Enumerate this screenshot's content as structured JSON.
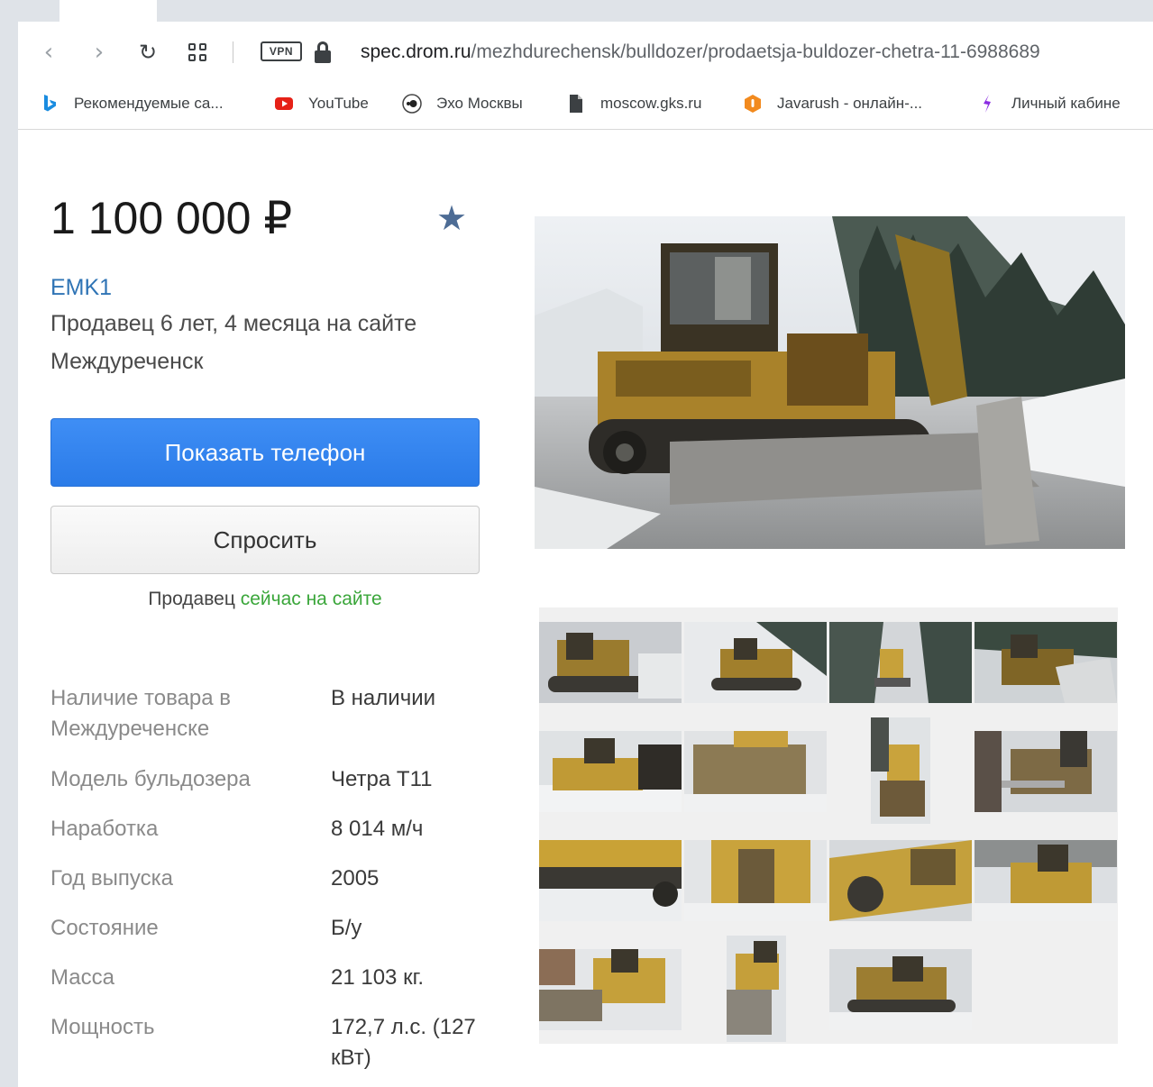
{
  "browser": {
    "url_host": "spec.drom.ru",
    "url_path": "/mezhdurechensk/bulldozer/prodaetsja-buldozer-chetra-11-6988689",
    "vpn_label": "VPN",
    "bookmarks": [
      {
        "label": "Рекомендуемые са...",
        "icon": "bing-icon"
      },
      {
        "label": "YouTube",
        "icon": "youtube-icon"
      },
      {
        "label": "Эхо Москвы",
        "icon": "echo-icon"
      },
      {
        "label": "moscow.gks.ru",
        "icon": "document-icon"
      },
      {
        "label": "Javarush - онлайн-...",
        "icon": "javarush-icon"
      },
      {
        "label": "Личный кабине",
        "icon": "cabinet-icon"
      }
    ]
  },
  "listing": {
    "price": "1 100 000 ₽",
    "seller_name": "EMK1",
    "seller_tenure": "Продавец 6 лет, 4 месяца на сайте",
    "seller_city": "Междуреченск",
    "show_phone_label": "Показать телефон",
    "ask_label": "Спросить",
    "online_prefix": "Продавец",
    "online_status": "сейчас на сайте"
  },
  "specs": [
    {
      "key": "Наличие товара в Междуреченске",
      "value": "В наличии"
    },
    {
      "key": "Модель бульдозера",
      "value": "Четра Т11"
    },
    {
      "key": "Наработка",
      "value": "8 014 м/ч"
    },
    {
      "key": "Год выпуска",
      "value": "2005"
    },
    {
      "key": "Состояние",
      "value": "Б/у"
    },
    {
      "key": "Масса",
      "value": "21 103 кг."
    },
    {
      "key": "Мощность",
      "value": "172,7 л.с. (127 кВт)"
    }
  ],
  "colors": {
    "primary_button": "#3f8ef5",
    "link": "#2f74b5",
    "online": "#3aa63a",
    "favorite_star": "#4d6c95"
  }
}
